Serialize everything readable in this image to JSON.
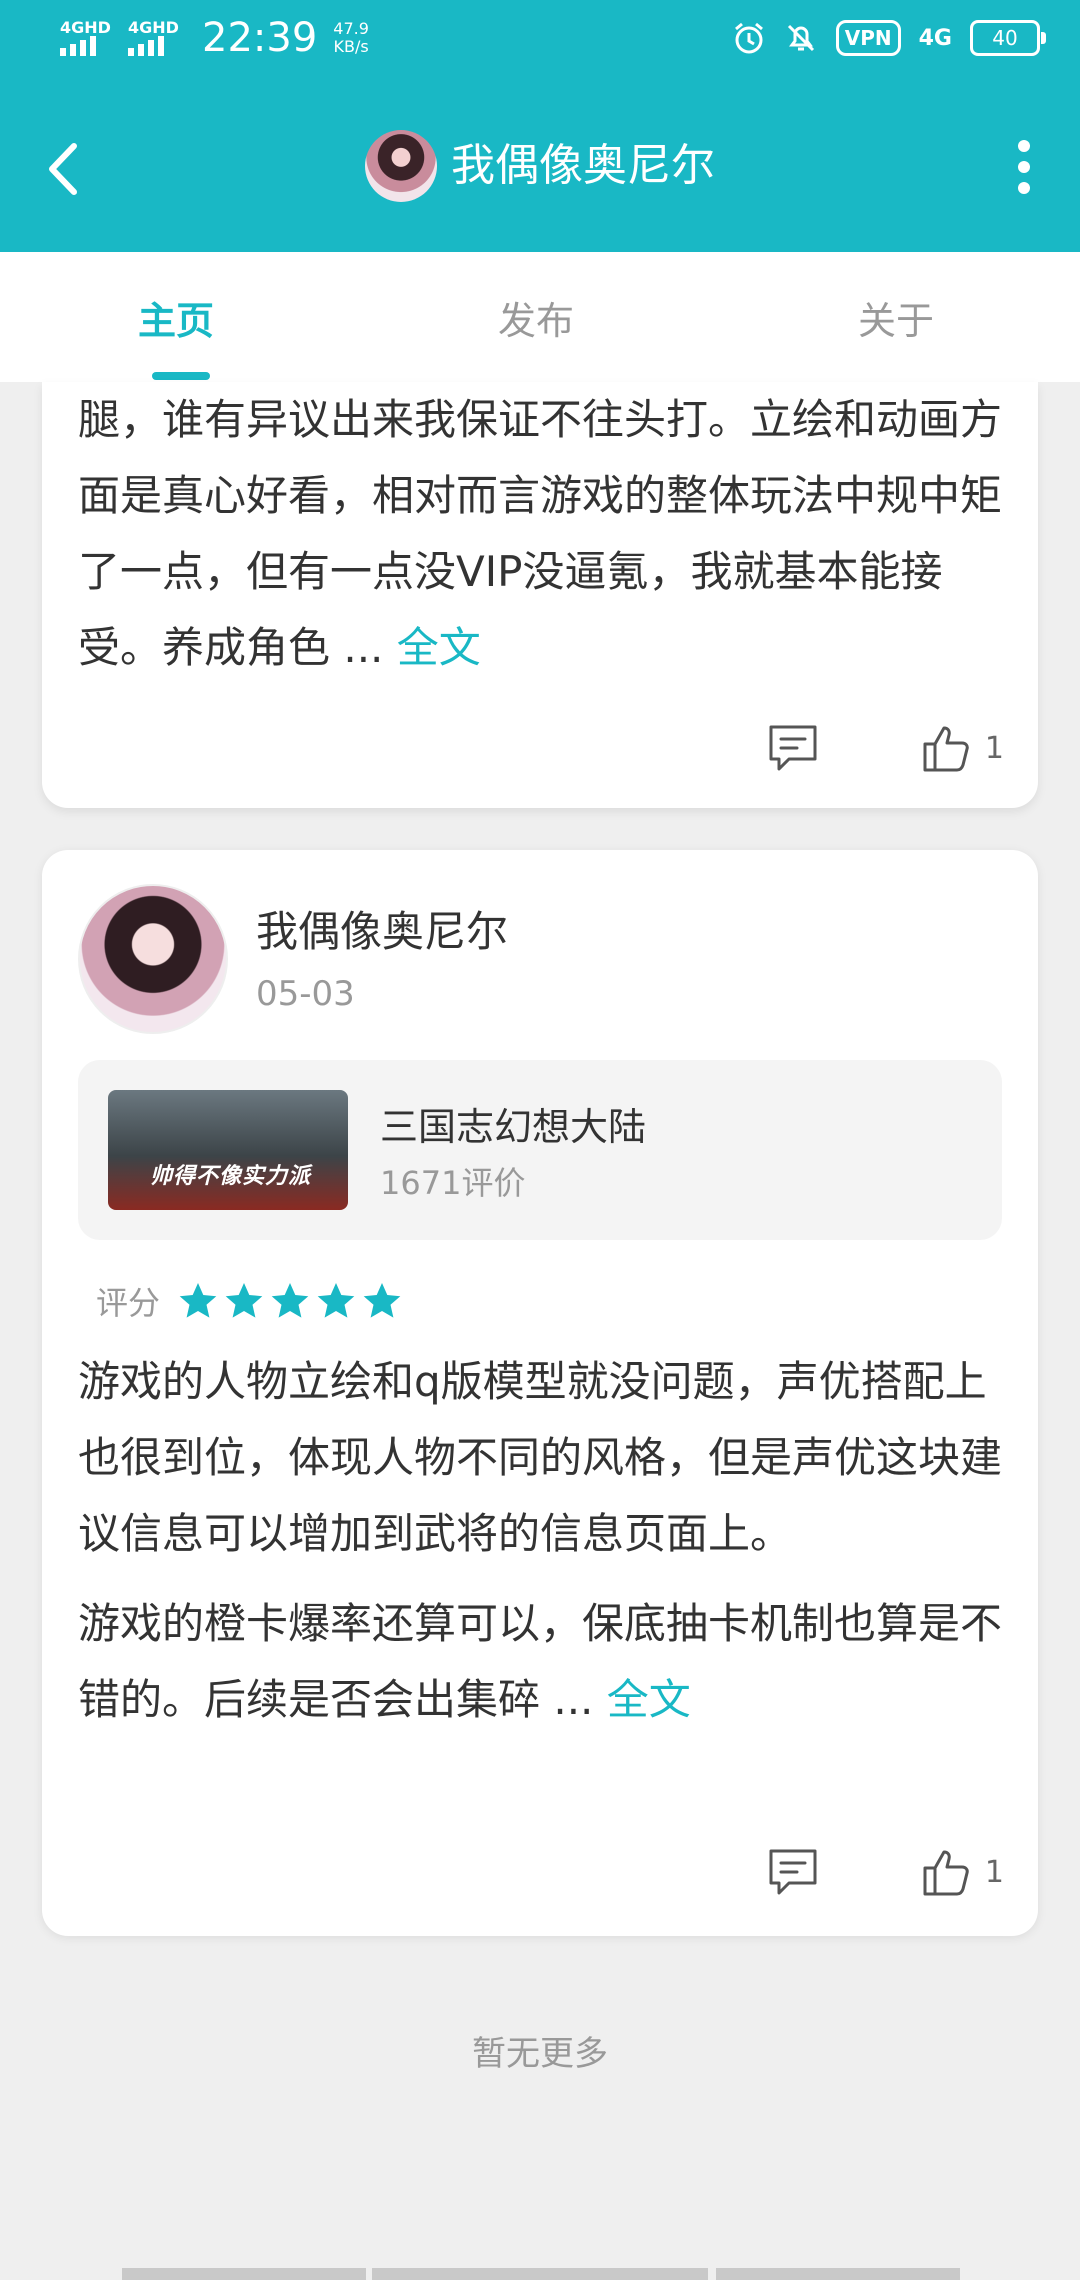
{
  "status": {
    "sim1": "4GHD",
    "sim2": "4GHD",
    "time": "22:39",
    "speed_value": "47.9",
    "speed_unit": "KB/s",
    "vpn": "VPN",
    "net": "4G",
    "battery": "40"
  },
  "header": {
    "title": "我偶像奥尼尔"
  },
  "tabs": [
    {
      "label": "主页",
      "active": true
    },
    {
      "label": "发布",
      "active": false
    },
    {
      "label": "关于",
      "active": false
    }
  ],
  "review1": {
    "text": "腿，谁有异议出来我保证不往头打。立绘和动画方面是真心好看，相对而言游戏的整体玩法中规中矩了一点，但有一点没VIP没逼氪，我就基本能接受。养成角色 ...",
    "full_label": "全文",
    "likes": "1"
  },
  "review2": {
    "username": "我偶像奥尼尔",
    "date": "05-03",
    "game": {
      "name": "三国志幻想大陆",
      "reviews": "1671评价",
      "banner_text": "帅得不像实力派"
    },
    "rating_label": "评分",
    "stars": 5,
    "paragraph1": "游戏的人物立绘和q版模型就没问题，声优搭配上也很到位，体现人物不同的风格，但是声优这块建议信息可以增加到武将的信息页面上。",
    "paragraph2": "游戏的橙卡爆率还算可以，保底抽卡机制也算是不错的。后续是否会出集碎 ...",
    "full_label": "全文",
    "likes": "1"
  },
  "footer": {
    "no_more": "暂无更多"
  },
  "colors": {
    "accent": "#19b8c5",
    "background": "#efefef"
  }
}
